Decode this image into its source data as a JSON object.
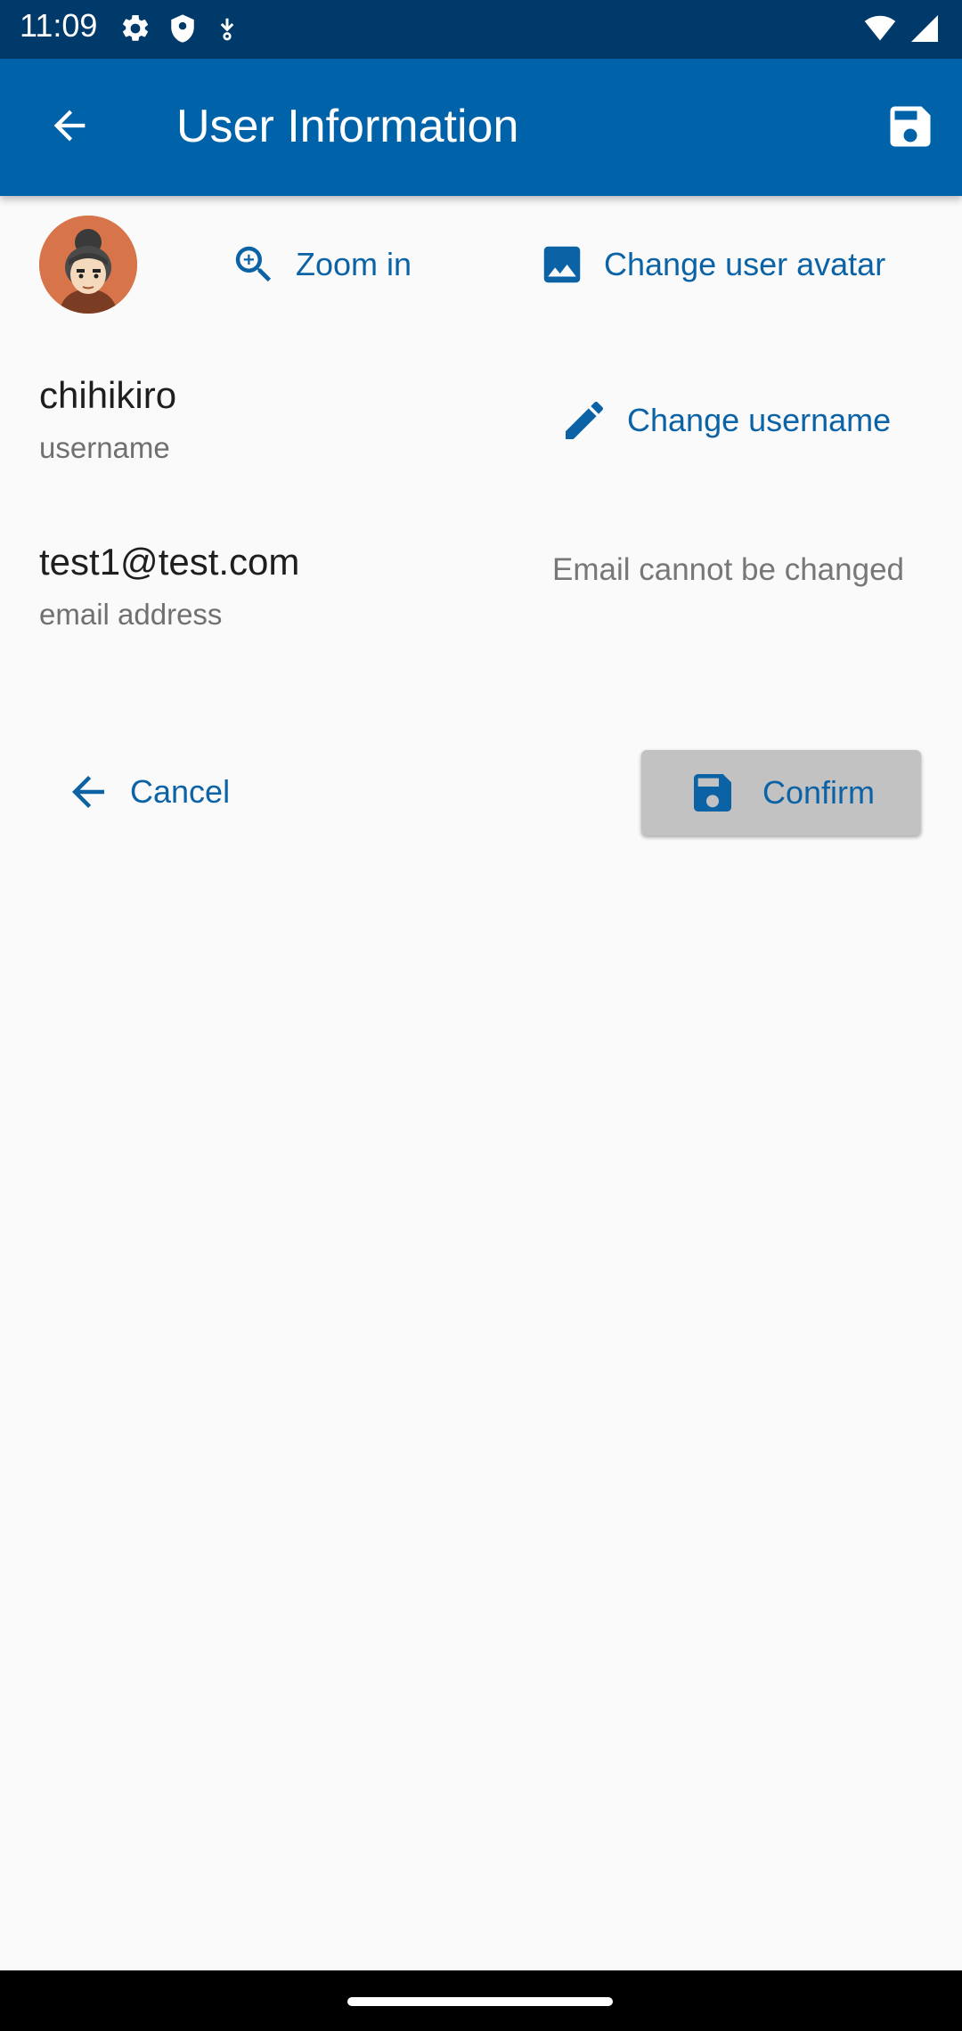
{
  "status_bar": {
    "time": "11:09",
    "icons_left": [
      "settings-icon",
      "shield-icon",
      "download-icon"
    ],
    "icons_right": [
      "wifi-icon",
      "cell-signal-icon"
    ]
  },
  "app_bar": {
    "title": "User Information",
    "back_icon": "arrow-back-icon",
    "save_icon": "save-icon",
    "background": "#0062a8"
  },
  "avatar_section": {
    "zoom_label": "Zoom in",
    "change_avatar_label": "Change user avatar"
  },
  "username_section": {
    "value": "chihikiro",
    "label": "username",
    "action_label": "Change username"
  },
  "email_section": {
    "value": "test1@test.com",
    "label": "email address",
    "note": "Email cannot be changed"
  },
  "actions": {
    "cancel_label": "Cancel",
    "confirm_label": "Confirm"
  },
  "colors": {
    "accent": "#0b63a6",
    "status_bar": "#003a6a"
  }
}
